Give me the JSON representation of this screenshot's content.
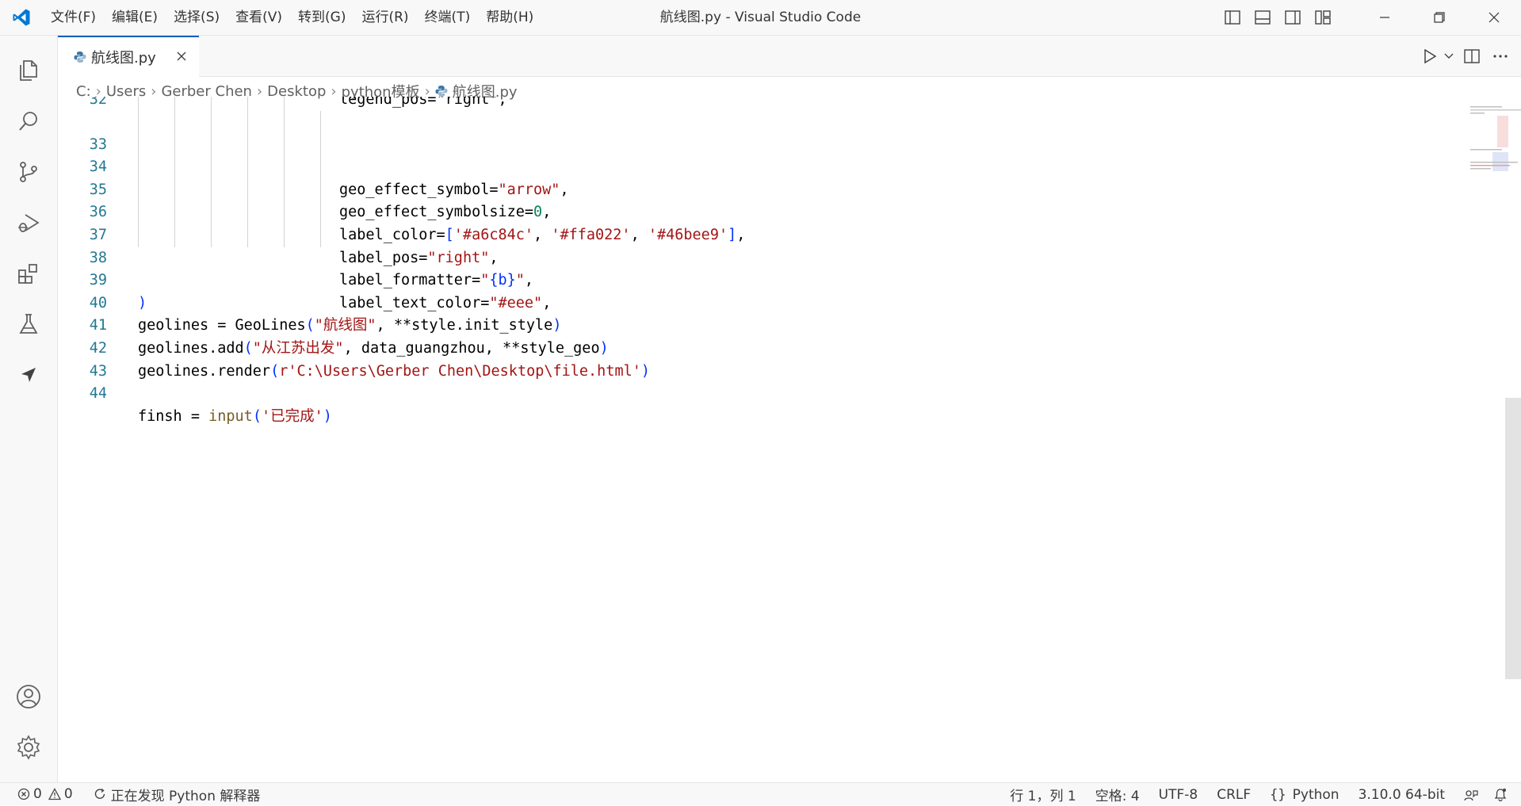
{
  "titlebar": {
    "menu": [
      "文件(F)",
      "编辑(E)",
      "选择(S)",
      "查看(V)",
      "转到(G)",
      "运行(R)",
      "终端(T)",
      "帮助(H)"
    ],
    "title": "航线图.py - Visual Studio Code"
  },
  "activity_bar": {
    "top_icons": [
      "explorer-icon",
      "search-icon",
      "source-control-icon",
      "run-debug-icon",
      "extensions-icon",
      "testing-icon",
      "remote-icon"
    ],
    "bottom_icons": [
      "accounts-icon",
      "manage-gear-icon"
    ]
  },
  "tab": {
    "label": "航线图.py",
    "file_icon": "python-file-icon",
    "close_icon": "close-icon"
  },
  "breadcrumbs": [
    "C:",
    "Users",
    "Gerber Chen",
    "Desktop",
    "python模板",
    "航线图.py"
  ],
  "editor": {
    "line_numbers": [
      "32",
      "33",
      "34",
      "35",
      "36",
      "37",
      "38",
      "39",
      "40",
      "41",
      "42",
      "43",
      "44"
    ],
    "partial_first_line": "legend_pos=\"right\",",
    "line33": {
      "a": "geo_effect_symbol=",
      "b": "\"arrow\"",
      "c": ","
    },
    "line34": {
      "a": "geo_effect_symbolsize=",
      "b": "0",
      "c": ","
    },
    "line35": {
      "a": "label_color=",
      "br1": "[",
      "s1": "'#a6c84c'",
      "s2": "'#ffa022'",
      "s3": "'#46bee9'",
      "br2": "]",
      "c": ",",
      "sep": ", "
    },
    "line36": {
      "a": "label_pos=",
      "b": "\"right\"",
      "c": ","
    },
    "line37": {
      "a": "label_formatter=",
      "q1": "\"",
      "br1": "{",
      "m": "b",
      "br2": "}",
      "q2": "\"",
      "c": ","
    },
    "line38": {
      "a": "label_text_color=",
      "b": "\"#eee\"",
      "c": ","
    },
    "line39": {
      "a": ")"
    },
    "line40": {
      "a": "geolines = GeoLines",
      "br1": "(",
      "s": "\"航线图\"",
      "b": ", **style.init_style",
      "br2": ")"
    },
    "line41": {
      "a": "geolines.add",
      "br1": "(",
      "s": "\"从江苏出发\"",
      "b": ", data_guangzhou, **style_geo",
      "br2": ")"
    },
    "line42": {
      "a": "geolines.render",
      "br1": "(",
      "s": "r'C:\\Users\\Gerber Chen\\Desktop\\file.html'",
      "br2": ")"
    },
    "line43": {
      "a": ""
    },
    "line44": {
      "a": "finsh = ",
      "f": "input",
      "br1": "(",
      "s": "'已完成'",
      "br2": ")"
    }
  },
  "statusbar": {
    "errors": "0",
    "warnings": "0",
    "discovering": "正在发现 Python 解释器",
    "position": "行 1，列 1",
    "spaces": "空格: 4",
    "encoding": "UTF-8",
    "eol": "CRLF",
    "language": "Python",
    "interpreter": "3.10.0 64-bit"
  }
}
